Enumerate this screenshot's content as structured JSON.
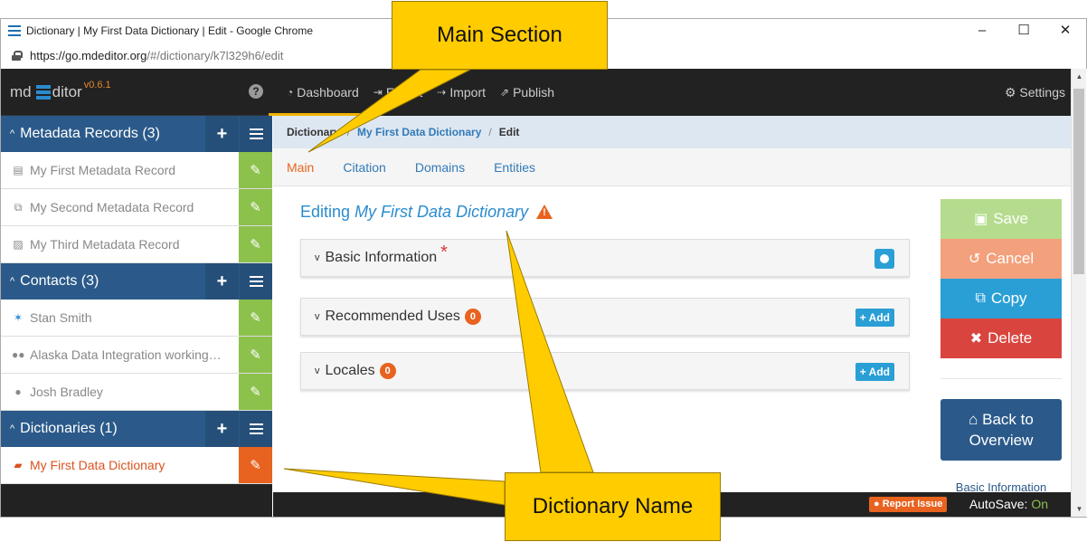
{
  "window": {
    "title": "Dictionary | My First Data Dictionary | Edit - Google Chrome",
    "url_host": "https://go.mdeditor.org",
    "url_path": "/#/dictionary/k7l329h6/edit",
    "controls": [
      "–",
      "☐",
      "✕"
    ]
  },
  "brand": {
    "md": "md",
    "editor": "ditor",
    "version": "v0.6.1",
    "help": "?"
  },
  "sidebar": {
    "sections": [
      {
        "title": "Metadata Records (3)",
        "items": [
          {
            "icon": "database-icon",
            "label": "My First Metadata Record"
          },
          {
            "icon": "copy-icon",
            "label": "My Second Metadata Record"
          },
          {
            "icon": "image-icon",
            "label": "My Third Metadata Record"
          }
        ]
      },
      {
        "title": "Contacts (3)",
        "items": [
          {
            "icon": "person-run-icon",
            "label": "Stan Smith"
          },
          {
            "icon": "group-icon",
            "label": "Alaska Data Integration working…"
          },
          {
            "icon": "user-icon",
            "label": "Josh Bradley"
          }
        ]
      },
      {
        "title": "Dictionaries (1)",
        "items": [
          {
            "icon": "book-icon",
            "label": "My First Data Dictionary"
          }
        ]
      }
    ]
  },
  "topnav": {
    "items": [
      "Dashboard",
      "Export",
      "Import",
      "Publish"
    ],
    "settings": "Settings"
  },
  "breadcrumb": {
    "root": "Dictionary",
    "name": "My First Data Dictionary",
    "current": "Edit",
    "sep": "/"
  },
  "subtabs": [
    "Main",
    "Citation",
    "Domains",
    "Entities"
  ],
  "editor": {
    "title_prefix": "Editing",
    "title_name": "My First Data Dictionary",
    "panels": [
      {
        "label": "Basic Information",
        "required_mark": "*"
      },
      {
        "label": "Recommended Uses",
        "badge": "0",
        "add_label": "+ Add"
      },
      {
        "label": "Locales",
        "badge": "0",
        "add_label": "+ Add"
      }
    ]
  },
  "actions": {
    "save": "Save",
    "cancel": "Cancel",
    "copy": "Copy",
    "delete": "Delete",
    "back_line1": "Back to",
    "back_line2": "Overview",
    "toc_first": "Basic Information"
  },
  "footer": {
    "report": "Report Issue",
    "autosave_label": "AutoSave:",
    "autosave_value": "On"
  },
  "callouts": {
    "main_section": "Main Section",
    "dictionary_name": "Dictionary Name"
  },
  "colors": {
    "sidebar_header": "#2b5a8a",
    "edit_green": "#8cc14c",
    "active_orange": "#e8631f",
    "callout_yellow": "#ffcc00",
    "link_blue": "#2a8ccf"
  }
}
